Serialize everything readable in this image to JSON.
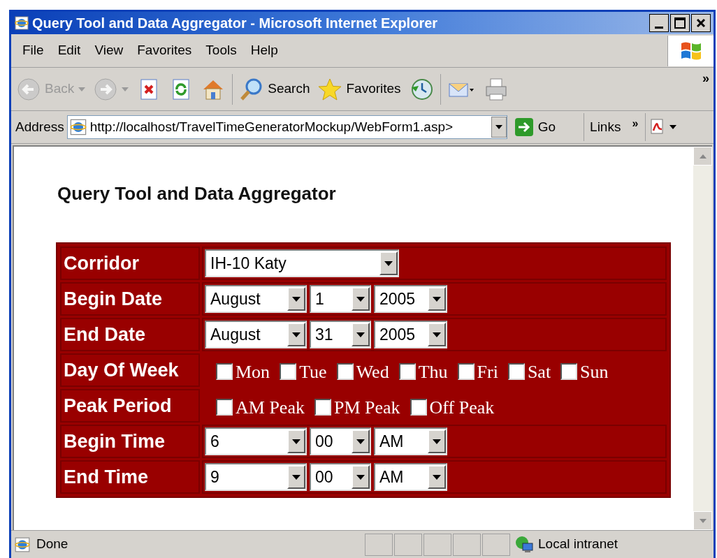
{
  "window": {
    "title": "Query Tool and Data Aggregator - Microsoft Internet Explorer"
  },
  "menu": [
    "File",
    "Edit",
    "View",
    "Favorites",
    "Tools",
    "Help"
  ],
  "toolbar": [
    {
      "kind": "back",
      "label": "Back",
      "disabled": true
    },
    {
      "kind": "forward",
      "disabled": true
    },
    {
      "kind": "stop"
    },
    {
      "kind": "refresh"
    },
    {
      "kind": "home"
    },
    {
      "kind": "search",
      "label": "Search"
    },
    {
      "kind": "favorites",
      "label": "Favorites"
    },
    {
      "kind": "history"
    },
    {
      "kind": "mail"
    },
    {
      "kind": "print"
    }
  ],
  "toolbar_more": "»",
  "address": {
    "label": "Address",
    "url": "http://localhost/TravelTimeGeneratorMockup/WebForm1.asp>",
    "go": "Go",
    "links": "Links",
    "links_more": "»"
  },
  "page": {
    "heading": "Query Tool and Data Aggregator",
    "rows": [
      {
        "label": "Corridor",
        "kind": "selects",
        "selects": [
          {
            "kind": "wide",
            "value": "IH-10 Katy"
          }
        ]
      },
      {
        "label": "Begin Date",
        "kind": "selects",
        "selects": [
          {
            "kind": "medium",
            "value": "August"
          },
          {
            "kind": "small",
            "value": "1"
          },
          {
            "kind": "year",
            "value": "2005"
          }
        ]
      },
      {
        "label": "End Date",
        "kind": "selects",
        "selects": [
          {
            "kind": "medium",
            "value": "August"
          },
          {
            "kind": "small",
            "value": "31"
          },
          {
            "kind": "year",
            "value": "2005"
          }
        ]
      },
      {
        "label": "Day Of Week",
        "kind": "checkboxes",
        "options": [
          {
            "label": "Mon",
            "checked": false
          },
          {
            "label": "Tue",
            "checked": false
          },
          {
            "label": "Wed",
            "checked": false
          },
          {
            "label": "Thu",
            "checked": false
          },
          {
            "label": "Fri",
            "checked": false
          },
          {
            "label": "Sat",
            "checked": false
          },
          {
            "label": "Sun",
            "checked": false
          }
        ]
      },
      {
        "label": "Peak Period",
        "kind": "checkboxes",
        "options": [
          {
            "label": "AM Peak",
            "checked": false
          },
          {
            "label": "PM Peak",
            "checked": false
          },
          {
            "label": "Off Peak",
            "checked": false
          }
        ]
      },
      {
        "label": "Begin Time",
        "kind": "selects",
        "selects": [
          {
            "kind": "medium",
            "value": "6"
          },
          {
            "kind": "small",
            "value": "00"
          },
          {
            "kind": "year",
            "value": "AM"
          }
        ]
      },
      {
        "label": "End Time",
        "kind": "selects",
        "selects": [
          {
            "kind": "medium",
            "value": "9"
          },
          {
            "kind": "small",
            "value": "00"
          },
          {
            "kind": "year",
            "value": "AM"
          }
        ]
      }
    ]
  },
  "status_bar": {
    "text": "Done",
    "zone": "Local intranet"
  }
}
